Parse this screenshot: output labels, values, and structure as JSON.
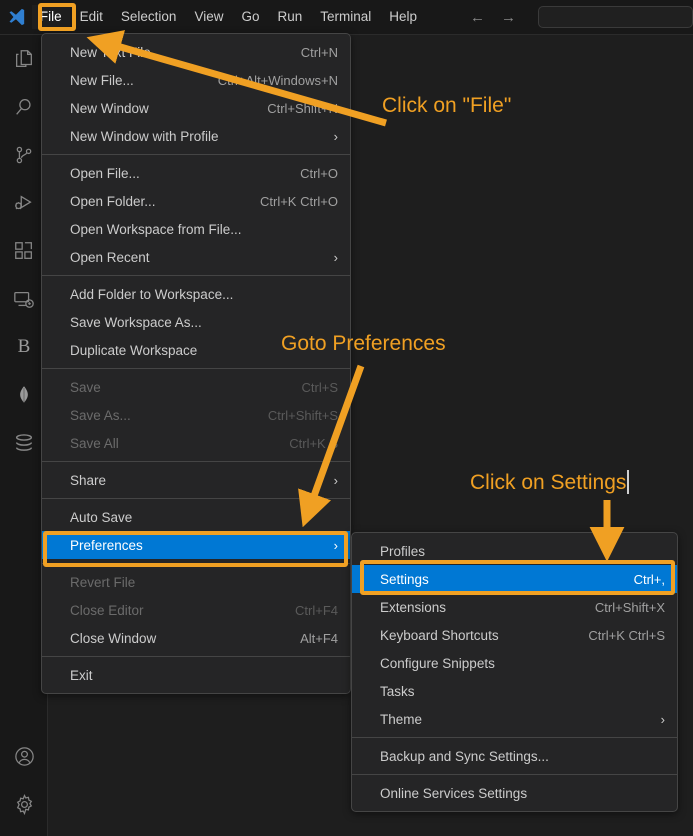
{
  "app": {
    "logo_icon": "vscode-logo-icon"
  },
  "menubar": {
    "items": [
      {
        "label": "File",
        "active": true
      },
      {
        "label": "Edit",
        "active": false
      },
      {
        "label": "Selection",
        "active": false
      },
      {
        "label": "View",
        "active": false
      },
      {
        "label": "Go",
        "active": false
      },
      {
        "label": "Run",
        "active": false
      },
      {
        "label": "Terminal",
        "active": false
      },
      {
        "label": "Help",
        "active": false
      }
    ],
    "nav_back_icon": "arrow-left-icon",
    "nav_forward_icon": "arrow-right-icon",
    "command_center_value": "",
    "command_center_placeholder": ""
  },
  "activitybar": {
    "items": [
      {
        "icon": "explorer-files-icon",
        "label": "Explorer"
      },
      {
        "icon": "search-icon",
        "label": "Search"
      },
      {
        "icon": "source-control-icon",
        "label": "Source Control"
      },
      {
        "icon": "run-and-debug-icon",
        "label": "Run and Debug"
      },
      {
        "icon": "extensions-icon",
        "label": "Extensions"
      },
      {
        "icon": "remote-explorer-icon",
        "label": "Remote Explorer"
      },
      {
        "icon": "bitbucket-b-icon",
        "label": "B"
      },
      {
        "icon": "mongodb-leaf-icon",
        "label": "MongoDB"
      },
      {
        "icon": "database-stack-icon",
        "label": "Database"
      }
    ],
    "bottom_items": [
      {
        "icon": "account-icon",
        "label": "Accounts"
      },
      {
        "icon": "gear-icon",
        "label": "Manage"
      }
    ]
  },
  "file_menu": {
    "groups": [
      [
        {
          "label": "New Text File",
          "key": "Ctrl+N",
          "disabled": false,
          "submenu": false,
          "selected": false
        },
        {
          "label": "New File...",
          "key": "Ctrl+Alt+Windows+N",
          "disabled": false,
          "submenu": false,
          "selected": false
        },
        {
          "label": "New Window",
          "key": "Ctrl+Shift+N",
          "disabled": false,
          "submenu": false,
          "selected": false
        },
        {
          "label": "New Window with Profile",
          "key": "",
          "disabled": false,
          "submenu": true,
          "selected": false
        }
      ],
      [
        {
          "label": "Open File...",
          "key": "Ctrl+O",
          "disabled": false,
          "submenu": false,
          "selected": false
        },
        {
          "label": "Open Folder...",
          "key": "Ctrl+K Ctrl+O",
          "disabled": false,
          "submenu": false,
          "selected": false
        },
        {
          "label": "Open Workspace from File...",
          "key": "",
          "disabled": false,
          "submenu": false,
          "selected": false
        },
        {
          "label": "Open Recent",
          "key": "",
          "disabled": false,
          "submenu": true,
          "selected": false
        }
      ],
      [
        {
          "label": "Add Folder to Workspace...",
          "key": "",
          "disabled": false,
          "submenu": false,
          "selected": false
        },
        {
          "label": "Save Workspace As...",
          "key": "",
          "disabled": false,
          "submenu": false,
          "selected": false
        },
        {
          "label": "Duplicate Workspace",
          "key": "",
          "disabled": false,
          "submenu": false,
          "selected": false
        }
      ],
      [
        {
          "label": "Save",
          "key": "Ctrl+S",
          "disabled": true,
          "submenu": false,
          "selected": false
        },
        {
          "label": "Save As...",
          "key": "Ctrl+Shift+S",
          "disabled": true,
          "submenu": false,
          "selected": false
        },
        {
          "label": "Save All",
          "key": "Ctrl+K S",
          "disabled": true,
          "submenu": false,
          "selected": false
        }
      ],
      [
        {
          "label": "Share",
          "key": "",
          "disabled": false,
          "submenu": true,
          "selected": false
        }
      ],
      [
        {
          "label": "Auto Save",
          "key": "",
          "disabled": false,
          "submenu": false,
          "selected": false
        },
        {
          "label": "Preferences",
          "key": "",
          "disabled": false,
          "submenu": true,
          "selected": true
        }
      ],
      [
        {
          "label": "Revert File",
          "key": "",
          "disabled": true,
          "submenu": false,
          "selected": false
        },
        {
          "label": "Close Editor",
          "key": "Ctrl+F4",
          "disabled": true,
          "submenu": false,
          "selected": false
        },
        {
          "label": "Close Window",
          "key": "Alt+F4",
          "disabled": false,
          "submenu": false,
          "selected": false
        }
      ],
      [
        {
          "label": "Exit",
          "key": "",
          "disabled": false,
          "submenu": false,
          "selected": false
        }
      ]
    ]
  },
  "preferences_menu": {
    "groups": [
      [
        {
          "label": "Profiles",
          "key": "",
          "disabled": false,
          "submenu": false,
          "selected": false
        },
        {
          "label": "Settings",
          "key": "Ctrl+,",
          "disabled": false,
          "submenu": false,
          "selected": true
        },
        {
          "label": "Extensions",
          "key": "Ctrl+Shift+X",
          "disabled": false,
          "submenu": false,
          "selected": false
        },
        {
          "label": "Keyboard Shortcuts",
          "key": "Ctrl+K Ctrl+S",
          "disabled": false,
          "submenu": false,
          "selected": false
        },
        {
          "label": "Configure Snippets",
          "key": "",
          "disabled": false,
          "submenu": false,
          "selected": false
        },
        {
          "label": "Tasks",
          "key": "",
          "disabled": false,
          "submenu": false,
          "selected": false
        },
        {
          "label": "Theme",
          "key": "",
          "disabled": false,
          "submenu": true,
          "selected": false
        }
      ],
      [
        {
          "label": "Backup and Sync Settings...",
          "key": "",
          "disabled": false,
          "submenu": false,
          "selected": false
        }
      ],
      [
        {
          "label": "Online Services Settings",
          "key": "",
          "disabled": false,
          "submenu": false,
          "selected": false
        }
      ]
    ]
  },
  "annotations": {
    "click_file": "Click on \"File\"",
    "goto_preferences": "Goto Preferences",
    "click_settings": "Click on Settings"
  },
  "colors": {
    "accent_orange": "#f0a023",
    "selection_blue": "#0078d4",
    "menu_bg": "#252526",
    "chrome_bg": "#181818",
    "editor_bg": "#1e1e1e",
    "text": "#cccccc",
    "text_disabled": "#6b6b6b"
  }
}
